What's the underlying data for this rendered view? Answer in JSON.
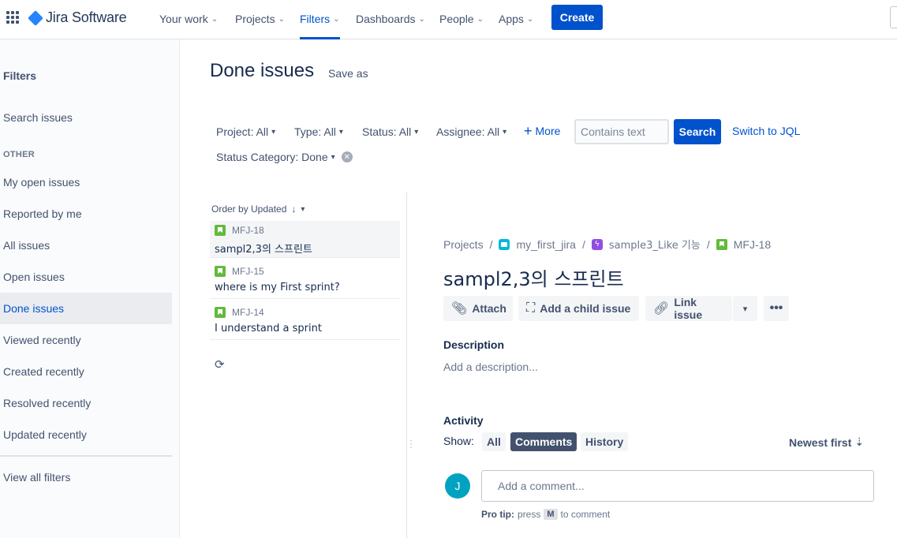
{
  "topnav": {
    "logo": "Jira Software",
    "items": [
      {
        "label": "Your work"
      },
      {
        "label": "Projects"
      },
      {
        "label": "Filters"
      },
      {
        "label": "Dashboards"
      },
      {
        "label": "People"
      },
      {
        "label": "Apps"
      }
    ],
    "create": "Create"
  },
  "sidebar": {
    "title": "Filters",
    "search": "Search issues",
    "heading": "OTHER",
    "items": [
      {
        "label": "My open issues"
      },
      {
        "label": "Reported by me"
      },
      {
        "label": "All issues"
      },
      {
        "label": "Open issues"
      },
      {
        "label": "Done issues"
      },
      {
        "label": "Viewed recently"
      },
      {
        "label": "Created recently"
      },
      {
        "label": "Resolved recently"
      },
      {
        "label": "Updated recently"
      }
    ],
    "view_all": "View all filters"
  },
  "header": {
    "title": "Done issues",
    "save_as": "Save as"
  },
  "filters": {
    "project": "Project: All",
    "type": "Type: All",
    "status": "Status: All",
    "assignee": "Assignee: All",
    "more": "More",
    "contains_placeholder": "Contains text",
    "search": "Search",
    "switch_jql": "Switch to JQL",
    "status_category": "Status Category: Done"
  },
  "list": {
    "order_by": "Order by Updated",
    "issues": [
      {
        "key": "MFJ-18",
        "summary": "sampl2,3의 스프린트"
      },
      {
        "key": "MFJ-15",
        "summary": "where is my First sprint?"
      },
      {
        "key": "MFJ-14",
        "summary": "I understand a sprint"
      }
    ]
  },
  "detail": {
    "breadcrumbs": {
      "projects": "Projects",
      "project": "my_first_jira",
      "epic": "sample3_Like 기능",
      "issue": "MFJ-18"
    },
    "title": "sampl2,3의 스프린트",
    "actions": {
      "attach": "Attach",
      "add_child": "Add a child issue",
      "link": "Link issue"
    },
    "description_label": "Description",
    "description_placeholder": "Add a description...",
    "activity_label": "Activity",
    "show_label": "Show:",
    "tabs": {
      "all": "All",
      "comments": "Comments",
      "history": "History"
    },
    "sort": "Newest first",
    "avatar_initial": "J",
    "comment_placeholder": "Add a comment...",
    "pro_tip": {
      "label": "Pro tip:",
      "press": "press",
      "key": "M",
      "suffix": "to comment"
    }
  }
}
